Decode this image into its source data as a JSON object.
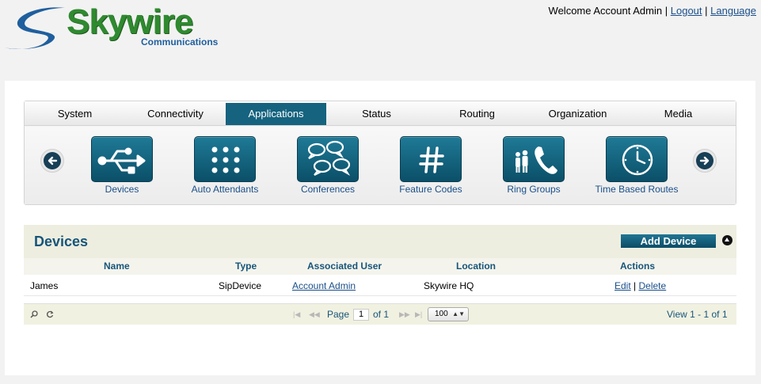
{
  "brand": {
    "name": "Skywire",
    "sub": "Communications",
    "colors": {
      "green": "#2f8a2f",
      "blue": "#1f5f9e",
      "accent": "#15637f"
    }
  },
  "user_bar": {
    "welcome": "Welcome Account Admin",
    "sep": "|",
    "logout": "Logout",
    "language": "Language"
  },
  "tabs": [
    {
      "label": "System",
      "active": false
    },
    {
      "label": "Connectivity",
      "active": false
    },
    {
      "label": "Applications",
      "active": true
    },
    {
      "label": "Status",
      "active": false
    },
    {
      "label": "Routing",
      "active": false
    },
    {
      "label": "Organization",
      "active": false
    },
    {
      "label": "Media",
      "active": false
    }
  ],
  "apps": [
    {
      "label": "Devices",
      "icon": "usb-icon"
    },
    {
      "label": "Auto Attendants",
      "icon": "keypad-icon"
    },
    {
      "label": "Conferences",
      "icon": "speech-bubbles-icon"
    },
    {
      "label": "Feature Codes",
      "icon": "hash-icon"
    },
    {
      "label": "Ring Groups",
      "icon": "people-phone-icon"
    },
    {
      "label": "Time Based Routes",
      "icon": "clock-icon"
    }
  ],
  "nav": {
    "prev_icon": "arrow-left-icon",
    "next_icon": "arrow-right-icon"
  },
  "grid": {
    "title": "Devices",
    "add_button": "Add Device",
    "columns": [
      "Name",
      "Type",
      "Associated User",
      "Location",
      "Actions"
    ],
    "rows": [
      {
        "name": "James",
        "type": "SipDevice",
        "user": "Account Admin",
        "location": "Skywire HQ",
        "edit": "Edit",
        "sep": "|",
        "delete": "Delete"
      }
    ],
    "pager": {
      "page_label": "Page",
      "page_value": "1",
      "of_label": "of 1",
      "rows_per_page": "100",
      "view_text": "View 1 - 1 of 1"
    }
  }
}
